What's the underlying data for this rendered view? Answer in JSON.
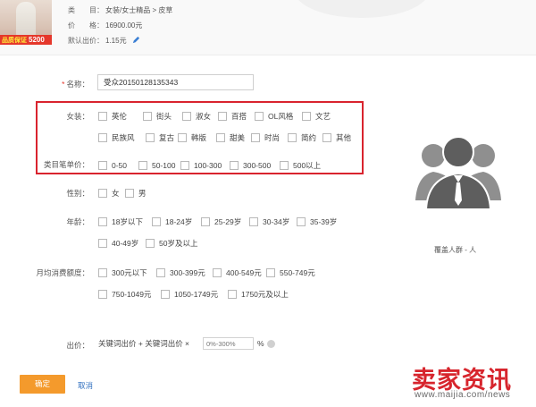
{
  "product": {
    "price_tag": "品质保证",
    "price_tag_big": "5200",
    "category_label": "类　　目：",
    "category_value": "女装/女士精品 > 皮草",
    "price_label": "价　　格：",
    "price_value": "16900.00元",
    "default_bid_label": "默认出价：",
    "default_bid_value": "1.15元"
  },
  "form": {
    "name_label": "名称：",
    "name_value": "受众20150128135343",
    "style_label": "女装：",
    "style_options": [
      "英伦",
      "街头",
      "淑女",
      "百搭",
      "OL风格",
      "文艺",
      "民族风",
      "复古",
      "韩版",
      "甜美",
      "时尚",
      "简约",
      "其他"
    ],
    "price_label": "类目笔单价：",
    "price_options": [
      "0-50",
      "50-100",
      "100-300",
      "300-500",
      "500以上"
    ],
    "gender_label": "性别：",
    "gender_options": [
      "女",
      "男"
    ],
    "age_label": "年龄：",
    "age_options": [
      "18岁以下",
      "18-24岁",
      "25-29岁",
      "30-34岁",
      "35-39岁",
      "40-49岁",
      "50岁及以上"
    ],
    "spend_label": "月均消费额度：",
    "spend_options": [
      "300元以下",
      "300-399元",
      "400-549元",
      "550-749元",
      "750-1049元",
      "1050-1749元",
      "1750元及以上"
    ],
    "bid_label": "出价：",
    "bid_formula": "关键词出价 + 关键词出价 ×",
    "bid_placeholder": "0%-300%",
    "bid_unit": "%"
  },
  "coverage": {
    "label": "覆盖人群 - 人"
  },
  "actions": {
    "confirm": "确定",
    "cancel": "取消"
  },
  "watermark": {
    "text": "卖家资讯",
    "url": "www.maijia.com/news"
  },
  "colors": {
    "highlight_box": "#d9232e",
    "confirm_button": "#f49a2c",
    "link": "#2f6fbf"
  }
}
